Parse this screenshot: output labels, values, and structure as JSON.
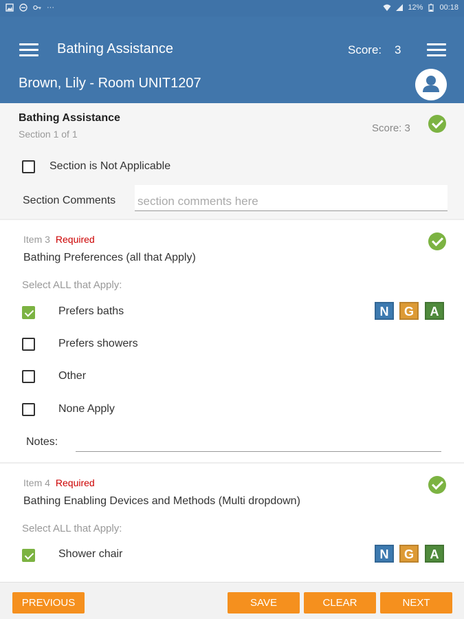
{
  "status_bar": {
    "battery": "12%",
    "time": "00:18",
    "dots": "···"
  },
  "header": {
    "title": "Bathing Assistance",
    "score_label": "Score:",
    "score_value": "3",
    "resident": "Brown, Lily - Room UNIT1207"
  },
  "section": {
    "name": "Bathing Assistance",
    "subtitle": "Section 1 of 1",
    "score": "Score: 3",
    "not_applicable_label": "Section is Not Applicable",
    "comments_label": "Section Comments",
    "comments_placeholder": "section comments here"
  },
  "items": [
    {
      "number": "Item 3",
      "required": "Required",
      "question": "Bathing Preferences (all that Apply)",
      "select_hint": "Select ALL that Apply:",
      "options": [
        {
          "label": "Prefers baths",
          "checked": true
        },
        {
          "label": "Prefers showers",
          "checked": false
        },
        {
          "label": "Other",
          "checked": false
        },
        {
          "label": "None Apply",
          "checked": false
        }
      ],
      "notes_label": "Notes:"
    },
    {
      "number": "Item 4",
      "required": "Required",
      "question": "Bathing Enabling Devices and Methods (Multi dropdown)",
      "select_hint": "Select ALL that Apply:",
      "options": [
        {
          "label": "Shower chair",
          "checked": true
        }
      ]
    }
  ],
  "nga": {
    "n": "N",
    "g": "G",
    "a": "A"
  },
  "buttons": {
    "previous": "PREVIOUS",
    "save": "SAVE",
    "clear": "CLEAR",
    "next": "NEXT"
  },
  "colors": {
    "header": "#4176ab",
    "accent": "#f5901e",
    "check": "#7cb342",
    "required": "#cc0000"
  },
  "icons": [
    "menu-icon",
    "avatar-icon",
    "check-circle-icon",
    "battery-icon",
    "signal-icon",
    "wifi-icon"
  ]
}
